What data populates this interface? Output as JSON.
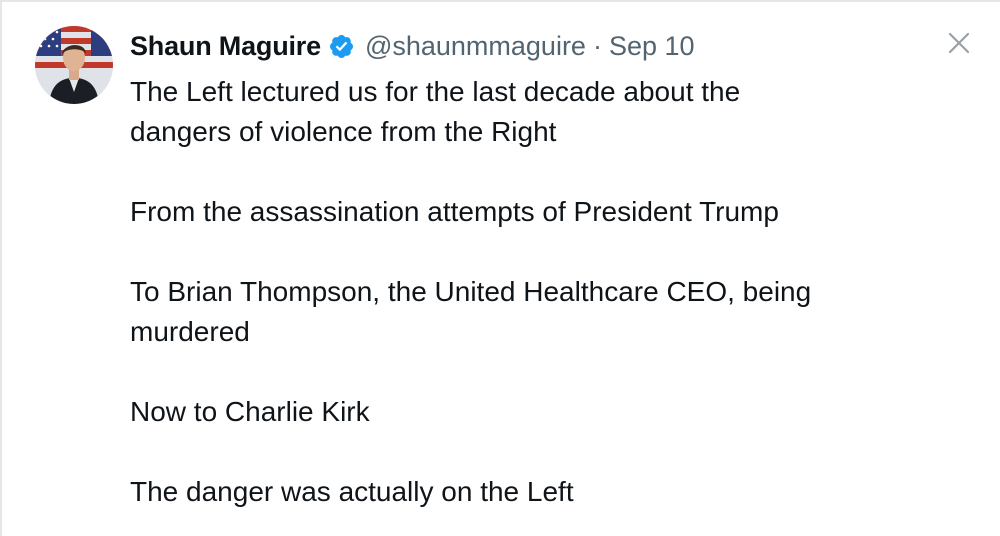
{
  "tweet": {
    "author_name": "Shaun Maguire",
    "handle": "@shaunmmaguire",
    "separator": "·",
    "date": "Sep 10",
    "paragraphs": [
      {
        "lines": [
          "The Left lectured us for the last decade about the",
          "dangers of violence from the Right"
        ]
      },
      {
        "lines": [
          "From the assassination attempts of President Trump"
        ]
      },
      {
        "lines": [
          "To Brian Thompson, the United Healthcare CEO, being",
          "murdered"
        ]
      },
      {
        "lines": [
          "Now to Charlie Kirk"
        ]
      },
      {
        "lines": [
          "The danger was actually on the Left"
        ]
      }
    ]
  },
  "icons": {
    "verified": "verified-badge-icon",
    "close": "close-icon"
  },
  "colors": {
    "verified_blue": "#1d9bf0",
    "text_primary": "#0f1419",
    "text_secondary": "#536471",
    "close_gray": "#9aa0a6"
  }
}
